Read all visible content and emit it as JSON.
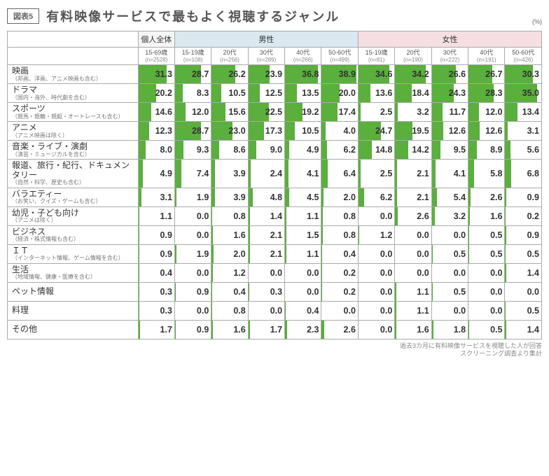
{
  "figure_label": "図表5",
  "title": "有料映像サービスで最もよく視聴するジャンル",
  "unit": "(%)",
  "footer_line1": "過去3カ月に有料映像サービスを視聴した人が回答",
  "footer_line2": "スクリーニング調査より集計",
  "groups": {
    "blank": "",
    "overall": "個人全体",
    "male": "男性",
    "female": "女性"
  },
  "columns": [
    {
      "key": "overall",
      "label": "15-69歳",
      "n": "(n=2528)"
    },
    {
      "key": "m15",
      "label": "15-19歳",
      "n": "(n=108)"
    },
    {
      "key": "m20",
      "label": "20代",
      "n": "(n=256)"
    },
    {
      "key": "m30",
      "label": "30代",
      "n": "(n=289)"
    },
    {
      "key": "m40",
      "label": "40代",
      "n": "(n=266)"
    },
    {
      "key": "m50",
      "label": "50-60代",
      "n": "(n=499)"
    },
    {
      "key": "f15",
      "label": "15-19歳",
      "n": "(n=81)"
    },
    {
      "key": "f20",
      "label": "20代",
      "n": "(n=190)"
    },
    {
      "key": "f30",
      "label": "30代",
      "n": "(n=222)"
    },
    {
      "key": "f40",
      "label": "40代",
      "n": "(n=191)"
    },
    {
      "key": "f50",
      "label": "50-60代",
      "n": "(n=426)"
    }
  ],
  "chart_data": {
    "type": "table",
    "bar_max": 40,
    "rows": [
      {
        "name": "映画",
        "sub": "（邦画、洋画、アニメ映画も含む）",
        "v": [
          31.3,
          28.7,
          26.2,
          23.9,
          36.8,
          38.9,
          34.6,
          34.2,
          26.6,
          26.7,
          30.3
        ]
      },
      {
        "name": "ドラマ",
        "sub": "（国内・海外、時代劇を含む）",
        "v": [
          20.2,
          8.3,
          10.5,
          12.5,
          13.5,
          20.0,
          13.6,
          18.4,
          24.3,
          28.3,
          35.0
        ]
      },
      {
        "name": "スポーツ",
        "sub": "（競馬・競輪・競艇・オートレースも含む）",
        "v": [
          14.6,
          12.0,
          15.6,
          22.5,
          19.2,
          17.4,
          2.5,
          3.2,
          11.7,
          12.0,
          13.4
        ]
      },
      {
        "name": "アニメ",
        "sub": "（アニメ映画は除く）",
        "v": [
          12.3,
          28.7,
          23.0,
          17.3,
          10.5,
          4.0,
          24.7,
          19.5,
          12.6,
          12.6,
          3.1
        ]
      },
      {
        "name": "音楽・ライブ・演劇",
        "sub": "（演芸・ミュージカルを含む）",
        "v": [
          8.0,
          9.3,
          8.6,
          9.0,
          4.9,
          6.2,
          14.8,
          14.2,
          9.5,
          8.9,
          5.6
        ]
      },
      {
        "name": "報道、旅行・紀行、ドキュメンタリー",
        "sub": "（自然・科学、歴史も含む）",
        "v": [
          4.9,
          7.4,
          3.9,
          2.4,
          4.1,
          6.4,
          2.5,
          2.1,
          4.1,
          5.8,
          6.8
        ]
      },
      {
        "name": "バラエティー",
        "sub": "（お笑い、クイズ・ゲームも含む）",
        "v": [
          3.1,
          1.9,
          3.9,
          4.8,
          4.5,
          2.0,
          6.2,
          2.1,
          5.4,
          2.6,
          0.9
        ]
      },
      {
        "name": "幼児・子ども向け",
        "sub": "（アニメは除く）",
        "v": [
          1.1,
          0.0,
          0.8,
          1.4,
          1.1,
          0.8,
          0.0,
          2.6,
          3.2,
          1.6,
          0.2
        ]
      },
      {
        "name": "ビジネス",
        "sub": "（経済・株式情報も含む）",
        "v": [
          0.9,
          0.0,
          1.6,
          2.1,
          1.5,
          0.8,
          1.2,
          0.0,
          0.0,
          0.5,
          0.9
        ]
      },
      {
        "name": "ＩＴ",
        "sub": "（インターネット情報、ゲーム情報を含む）",
        "v": [
          0.9,
          1.9,
          2.0,
          2.1,
          1.1,
          0.4,
          0.0,
          0.0,
          0.5,
          0.5,
          0.5
        ]
      },
      {
        "name": "生活",
        "sub": "（地域情報、健康・医療を含む）",
        "v": [
          0.4,
          0.0,
          1.2,
          0.0,
          0.0,
          0.2,
          0.0,
          0.0,
          0.0,
          0.0,
          1.4
        ]
      },
      {
        "name": "ペット情報",
        "sub": "",
        "v": [
          0.3,
          0.9,
          0.4,
          0.3,
          0.0,
          0.2,
          0.0,
          1.1,
          0.5,
          0.0,
          0.0
        ]
      },
      {
        "name": "料理",
        "sub": "",
        "v": [
          0.3,
          0.0,
          0.8,
          0.0,
          0.4,
          0.0,
          0.0,
          1.1,
          0.0,
          0.0,
          0.5
        ]
      },
      {
        "name": "その他",
        "sub": "",
        "v": [
          1.7,
          0.9,
          1.6,
          1.7,
          2.3,
          2.6,
          0.0,
          1.6,
          1.8,
          0.5,
          1.4
        ]
      }
    ]
  }
}
